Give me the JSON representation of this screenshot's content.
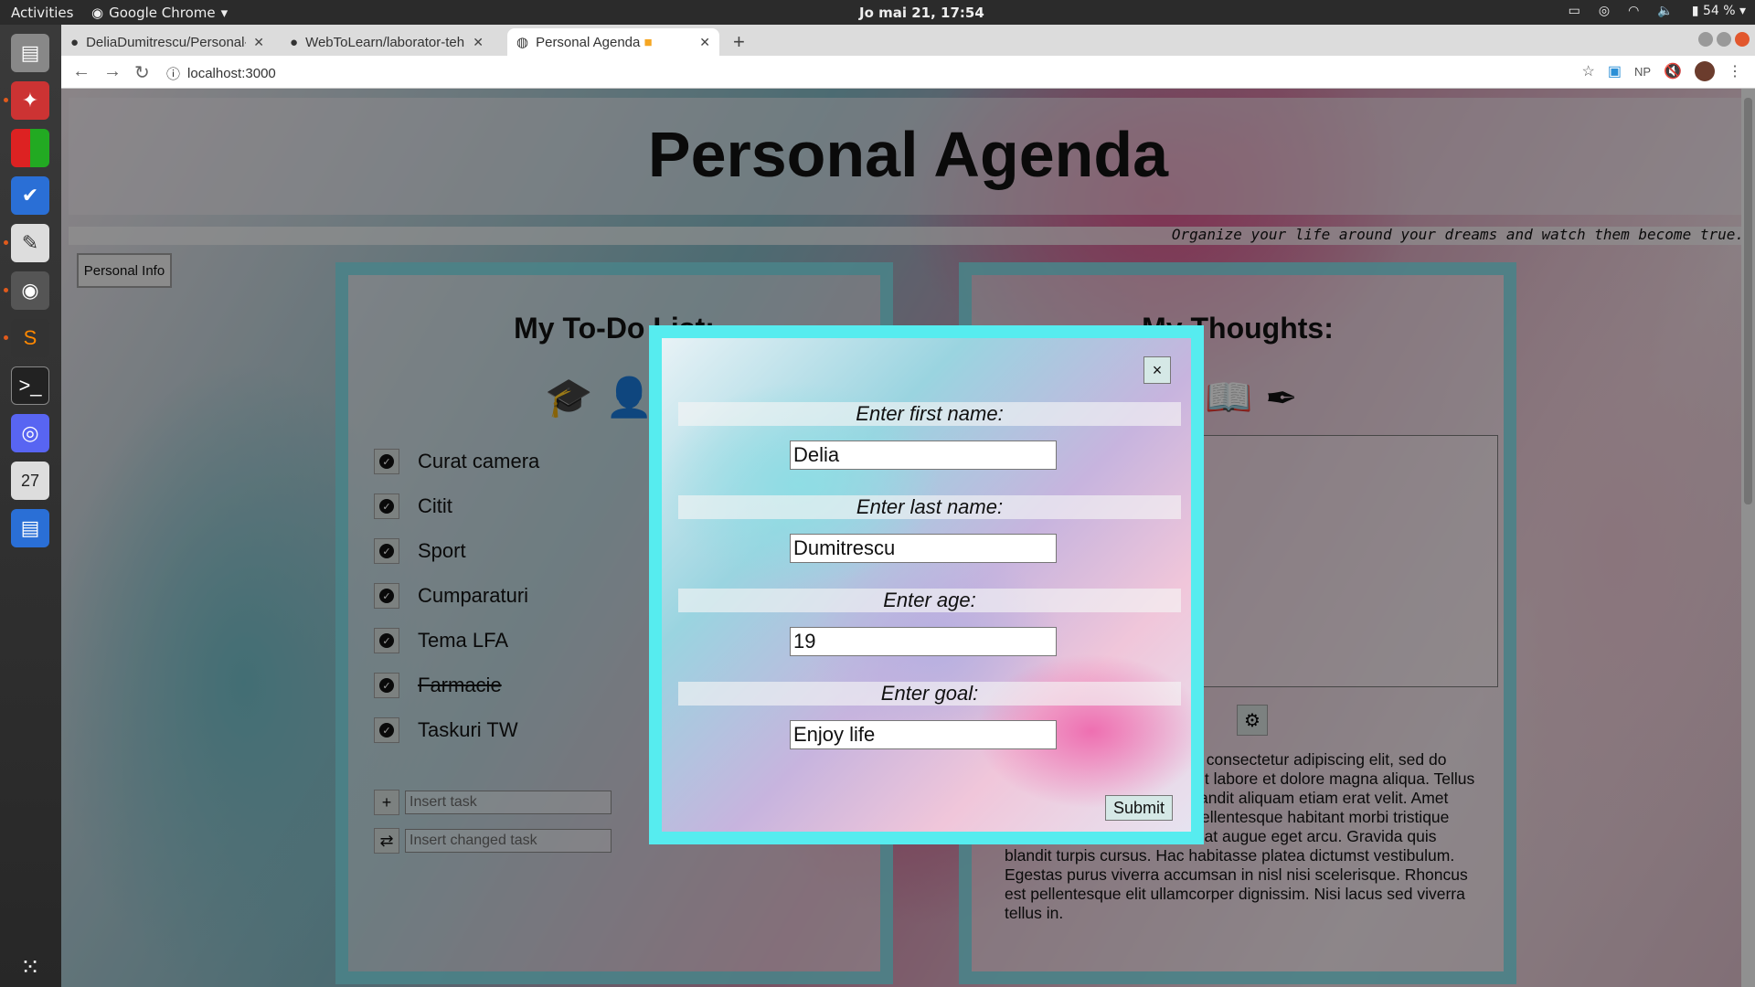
{
  "system": {
    "activities": "Activities",
    "app_name": "Google Chrome",
    "clock": "Jo mai 21, 17:54",
    "battery": "54 %"
  },
  "browser": {
    "tabs": [
      {
        "title": "DeliaDumitrescu/Personal-"
      },
      {
        "title": "WebToLearn/laborator-tehn"
      },
      {
        "title": "Personal Agenda"
      }
    ],
    "url": "localhost:3000",
    "ext_np": "NP"
  },
  "page": {
    "title": "Personal Agenda",
    "quote": "Organize your life around your dreams and watch them become true.",
    "personal_info_button": "Personal Info",
    "todo": {
      "title": "My To-Do List:",
      "tasks": [
        {
          "label": "Curat camera",
          "done": false
        },
        {
          "label": "Citit",
          "done": false
        },
        {
          "label": "Sport",
          "done": false
        },
        {
          "label": "Cumparaturi",
          "done": false
        },
        {
          "label": "Tema LFA",
          "done": false
        },
        {
          "label": "Farmacie",
          "done": true
        },
        {
          "label": "Taskuri TW",
          "done": false
        }
      ],
      "insert_placeholder": "Insert task",
      "change_placeholder": "Insert changed task"
    },
    "thoughts": {
      "title": "My Thoughts:",
      "lorem": "Lorem ipsum dolor sit amet, consectetur adipiscing elit, sed do eiusmod tempor incididunt ut labore et dolore magna aliqua. Tellus integer feugiat in tempor. Blandit aliquam etiam erat velit. Amet consectetur adipiscing elit pellentesque habitant morbi tristique senectus et netus. Vivamus at augue eget arcu. Gravida quis blandit turpis cursus. Hac habitasse platea dictumst vestibulum. Egestas purus viverra accumsan in nisl nisi scelerisque. Rhoncus est pellentesque elit ullamcorper dignissim. Nisi lacus sed viverra tellus in."
    }
  },
  "modal": {
    "close": "×",
    "first_name_label": "Enter first name:",
    "first_name_value": "Delia",
    "last_name_label": "Enter last name:",
    "last_name_value": "Dumitrescu",
    "age_label": "Enter age:",
    "age_value": "19",
    "goal_label": "Enter goal:",
    "goal_value": "Enjoy life",
    "submit": "Submit"
  },
  "colors": {
    "modal_border": "#56ecef",
    "panel_border": "#6ed7e1"
  }
}
